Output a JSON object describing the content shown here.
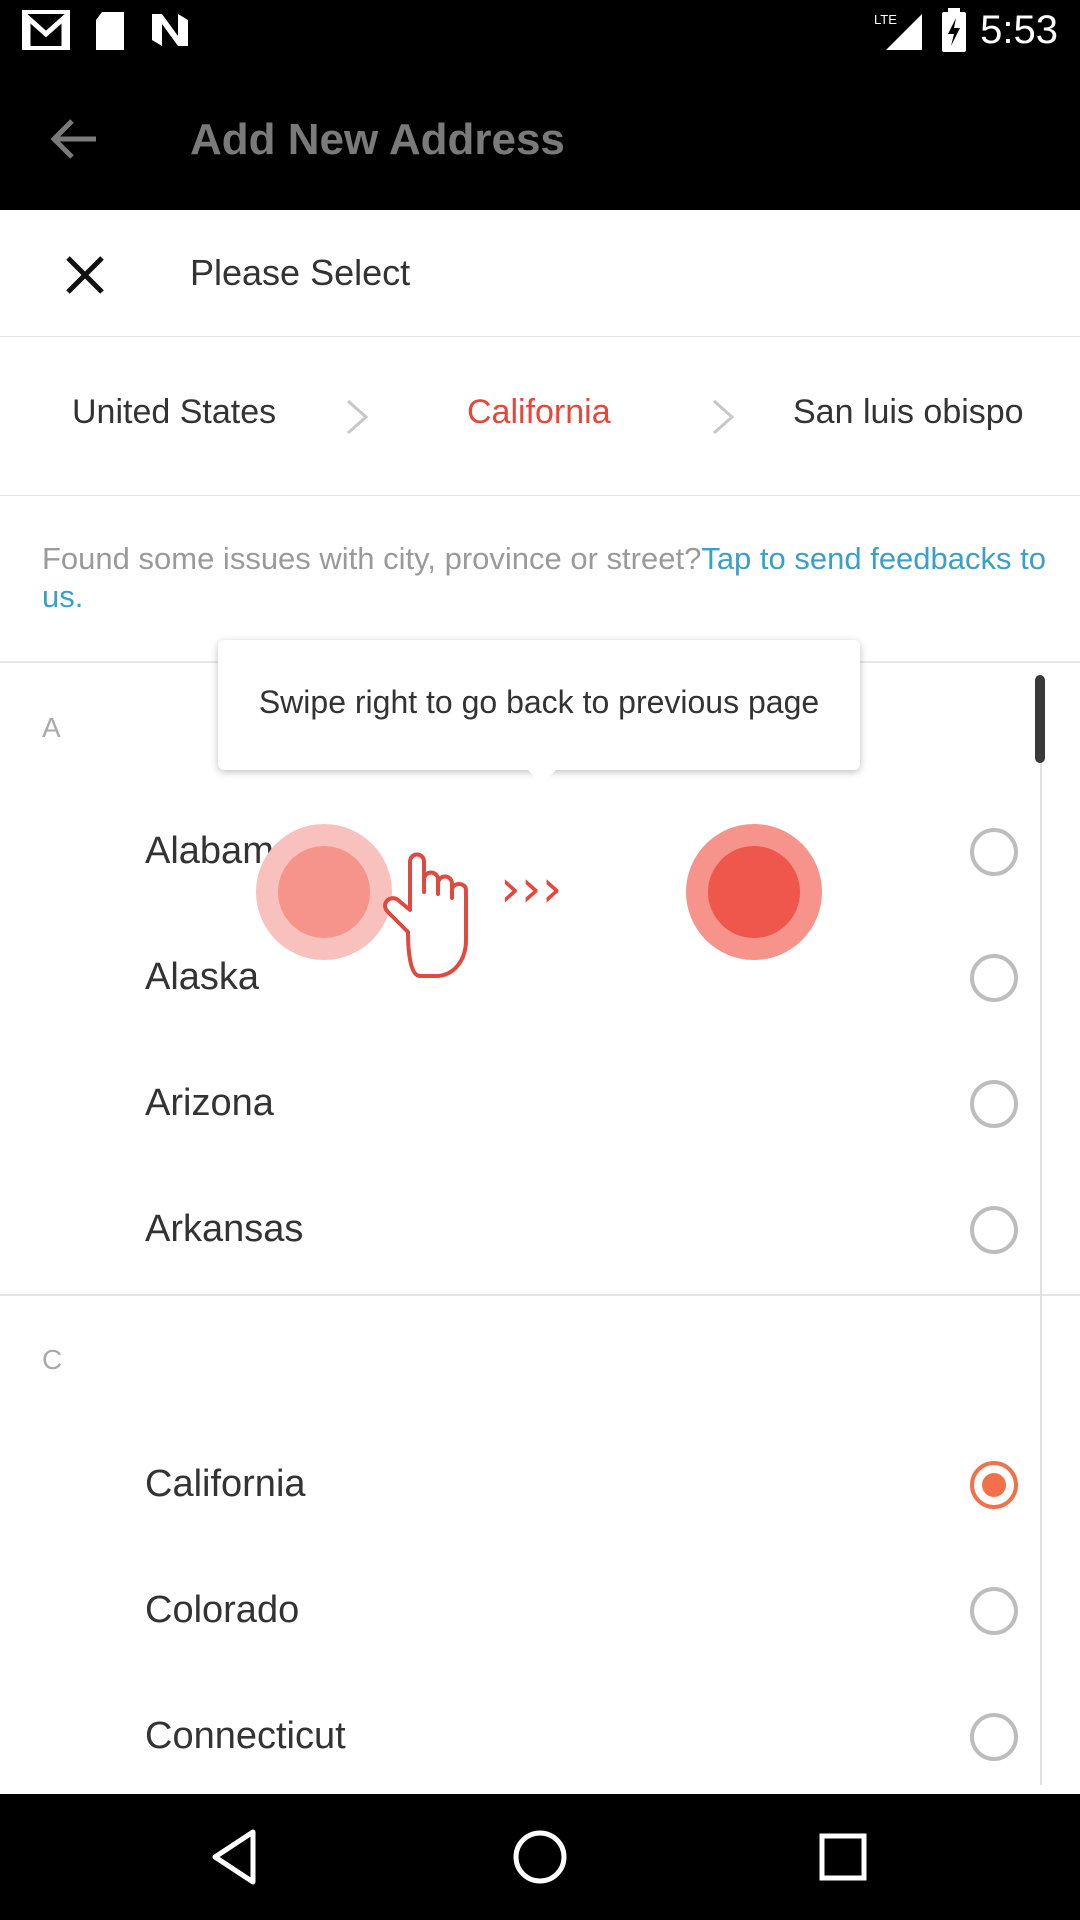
{
  "status_bar": {
    "time": "5:53",
    "network": "LTE",
    "icons": [
      "gmail-icon",
      "sd-card-icon",
      "n-icon",
      "signal-icon",
      "battery-charging-icon"
    ]
  },
  "app_bar": {
    "title": "Add New Address",
    "back_icon": "arrow-left-icon"
  },
  "sheet": {
    "title": "Please Select",
    "close_icon": "close-icon"
  },
  "breadcrumb": {
    "items": [
      {
        "label": "United States",
        "active": false
      },
      {
        "label": "California",
        "active": true
      },
      {
        "label": "San luis obispo",
        "active": false
      }
    ]
  },
  "notice": {
    "text": "Found some issues with city, province or street?",
    "link": "Tap to send feedbacks to us."
  },
  "tooltip": {
    "text": "Swipe right to go back to previous page"
  },
  "gesture_hint": {
    "arrows": "›››"
  },
  "groups": [
    {
      "letter": "A",
      "items": [
        {
          "name": "Alabama",
          "selected": false
        },
        {
          "name": "Alaska",
          "selected": false
        },
        {
          "name": "Arizona",
          "selected": false
        },
        {
          "name": "Arkansas",
          "selected": false
        }
      ]
    },
    {
      "letter": "C",
      "items": [
        {
          "name": "California",
          "selected": true
        },
        {
          "name": "Colorado",
          "selected": false
        },
        {
          "name": "Connecticut",
          "selected": false
        }
      ]
    }
  ],
  "colors": {
    "accent": "#e8463a",
    "radio_selected": "#f2714a",
    "link": "#3aa0c8"
  },
  "nav_bar": {
    "icons": [
      "back-triangle-icon",
      "home-circle-icon",
      "recents-square-icon"
    ]
  }
}
